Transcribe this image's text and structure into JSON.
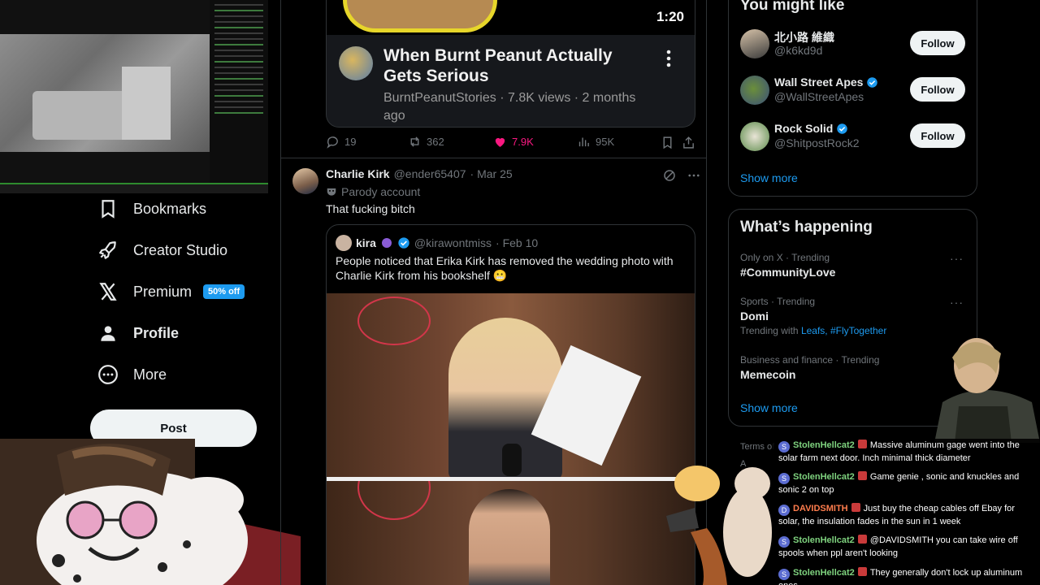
{
  "sidebar": {
    "nav": [
      {
        "label": "Bookmarks",
        "icon": "bookmark-icon"
      },
      {
        "label": "Creator Studio",
        "icon": "rocket-icon"
      },
      {
        "label": "Premium",
        "icon": "x-logo-icon",
        "badge": "50% off"
      },
      {
        "label": "Profile",
        "icon": "person-icon"
      },
      {
        "label": "More",
        "icon": "more-circle-icon"
      }
    ],
    "post_label": "Post"
  },
  "video_card": {
    "duration": "1:20",
    "title": "When Burnt Peanut Actually Gets Serious",
    "meta": "BurntPeanutStories · 7.8K views · 2 months ago"
  },
  "video_actions": {
    "replies": "19",
    "reposts": "362",
    "likes": "7.9K",
    "views": "95K",
    "like_color": "#f91880"
  },
  "tweet": {
    "name": "Charlie Kirk",
    "handle": "@ender65407",
    "date": "· Mar 25",
    "parody": "Parody account",
    "text": "That fucking bitch",
    "quote": {
      "name": "kira",
      "handle": "@kirawontmiss",
      "date": "· Feb 10",
      "text": "People noticed that Erika Kirk has removed the wedding photo with Charlie Kirk from his bookshelf 😬"
    }
  },
  "you_might_like": {
    "title": "You might like",
    "users": [
      {
        "name": "北小路 維織",
        "handle": "@k6kd9d",
        "verified": false,
        "follow": "Follow"
      },
      {
        "name": "Wall Street Apes",
        "handle": "@WallStreetApes",
        "verified": true,
        "follow": "Follow"
      },
      {
        "name": "Rock Solid",
        "handle": "@ShitpostRock2",
        "verified": true,
        "follow": "Follow"
      }
    ],
    "show_more": "Show more"
  },
  "happening": {
    "title": "What’s happening",
    "trends": [
      {
        "context": "Only on X · Trending",
        "topic": "#CommunityLove"
      },
      {
        "context": "Sports · Trending",
        "topic": "Domi",
        "with_prefix": "Trending with",
        "with_links": "Leafs, #FlyTogether"
      },
      {
        "context": "Business and finance · Trending",
        "topic": "Memecoin"
      }
    ],
    "show_more": "Show more"
  },
  "footer": {
    "terms": "Terms of",
    "terms2": "A"
  },
  "stream_chat": [
    {
      "user": "StolenHellcat2",
      "user_color": "#7fd37f",
      "text": "Massive aluminum gage went into the solar farm next door. Inch minimal thick diameter",
      "initial": "S"
    },
    {
      "user": "StolenHellcat2",
      "user_color": "#7fd37f",
      "text": "Game genie , sonic and knuckles and sonic 2 on top",
      "initial": "S"
    },
    {
      "user": "DAVIDSMITH",
      "user_color": "#ff7d4d",
      "text": "Just buy the cheap cables off Ebay for solar, the insulation fades in the sun in 1 week",
      "initial": "D"
    },
    {
      "user": "StolenHellcat2",
      "user_color": "#7fd37f",
      "text": "@DAVIDSMITH you can take wire off spools when ppl aren't looking",
      "initial": "S"
    },
    {
      "user": "StolenHellcat2",
      "user_color": "#7fd37f",
      "text": "They generally don't lock up aluminum ones",
      "initial": "S"
    }
  ],
  "colors": {
    "accent": "#1d9bf0",
    "bg": "#000000",
    "border": "#2f3336"
  }
}
